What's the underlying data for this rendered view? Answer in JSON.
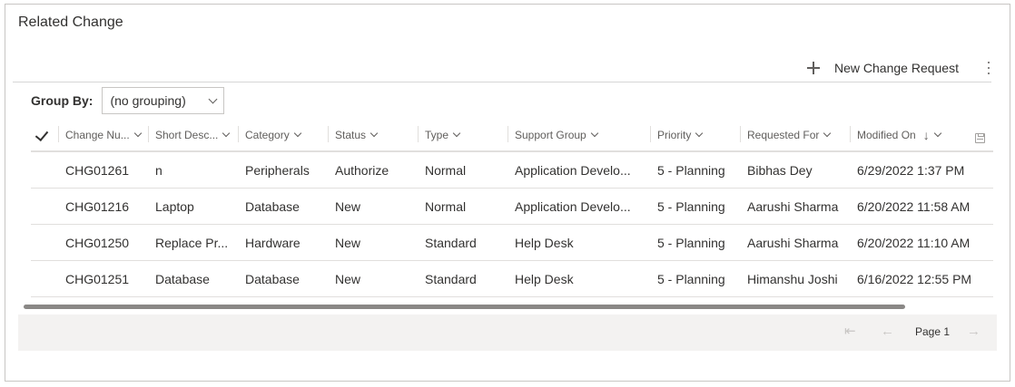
{
  "panel": {
    "title": "Related Change"
  },
  "commands": {
    "new_label": "New Change Request",
    "new_icon": "plus-icon",
    "more_icon": "more-vertical-icon"
  },
  "groupby": {
    "label": "Group By:",
    "value": "(no grouping)"
  },
  "columns": [
    {
      "label": "Change Nu...",
      "chevron": true
    },
    {
      "label": "Short Desc...",
      "chevron": true
    },
    {
      "label": "Category",
      "chevron": true
    },
    {
      "label": "Status",
      "chevron": true
    },
    {
      "label": "Type",
      "chevron": true
    },
    {
      "label": "Support Group",
      "chevron": true
    },
    {
      "label": "Priority",
      "chevron": true
    },
    {
      "label": "Requested For",
      "chevron": true
    },
    {
      "label": "Modified On",
      "chevron": true,
      "sort": "↓"
    }
  ],
  "rows": [
    [
      "CHG01261",
      "n",
      "Peripherals",
      "Authorize",
      "Normal",
      "Application Develo...",
      "5 - Planning",
      "Bibhas Dey",
      "6/29/2022 1:37 PM"
    ],
    [
      "CHG01216",
      "Laptop",
      "Database",
      "New",
      "Normal",
      "Application Develo...",
      "5 - Planning",
      "Aarushi Sharma",
      "6/20/2022 11:58 AM"
    ],
    [
      "CHG01250",
      "Replace Pr...",
      "Hardware",
      "New",
      "Standard",
      "Help Desk",
      "5 - Planning",
      "Aarushi Sharma",
      "6/20/2022 11:10 AM"
    ],
    [
      "CHG01251",
      "Database",
      "Database",
      "New",
      "Standard",
      "Help Desk",
      "5 - Planning",
      "Himanshu Joshi",
      "6/16/2022 12:55 PM"
    ]
  ],
  "pager": {
    "page_label": "Page 1",
    "first": "⇤",
    "prev": "←",
    "next": "→"
  }
}
